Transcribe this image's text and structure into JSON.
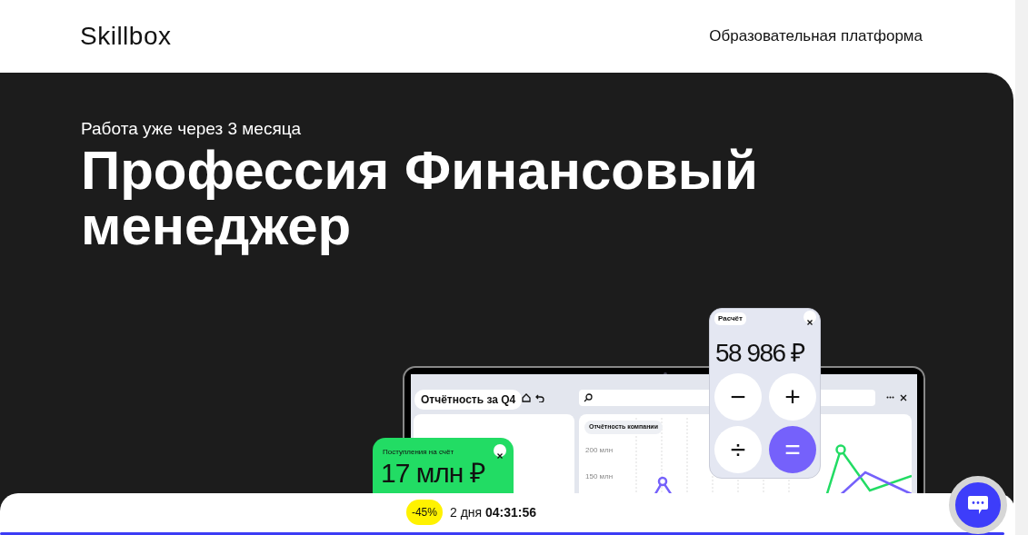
{
  "header": {
    "logo": "Skillbox",
    "tagline": "Образовательная платформа"
  },
  "hero": {
    "eyebrow": "Работа уже через 3 месяца",
    "title": "Профессия Финансовый менеджер"
  },
  "illustration": {
    "app_title": "Отчётность за Q4",
    "chart_title": "Отчётность компании",
    "axis_labels": [
      "200 млн",
      "150 млн"
    ],
    "income_card": {
      "label": "Поступления на счёт",
      "amount": "17 млн ₽"
    },
    "calculator": {
      "label": "Расчёт",
      "display": "58 986 ₽",
      "keys": [
        {
          "symbol": "−",
          "kind": "plain"
        },
        {
          "symbol": "+",
          "kind": "plain"
        },
        {
          "symbol": "÷",
          "kind": "plain"
        },
        {
          "symbol": "=",
          "kind": "accent"
        }
      ]
    }
  },
  "promo": {
    "discount": "-45%",
    "countdown": "2 дня **04:31:56**"
  }
}
